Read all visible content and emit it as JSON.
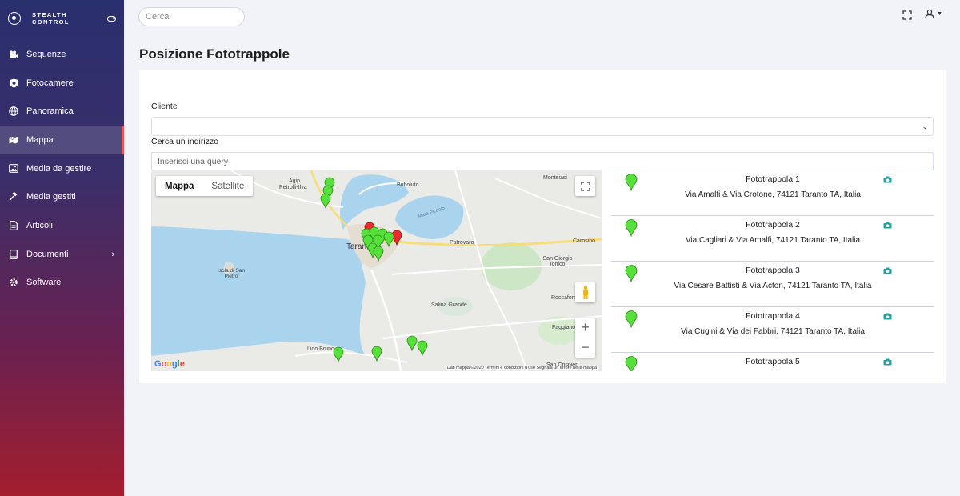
{
  "brand": {
    "name": "STEALTH CONTROL"
  },
  "sidebar": {
    "items": [
      {
        "label": "Sequenze",
        "icon": "video-camera-icon"
      },
      {
        "label": "Fotocamere",
        "icon": "camera-shield-icon"
      },
      {
        "label": "Panoramica",
        "icon": "globe-icon"
      },
      {
        "label": "Mappa",
        "icon": "map-icon",
        "active": true
      },
      {
        "label": "Media da gestire",
        "icon": "image-icon"
      },
      {
        "label": "Media gestiti",
        "icon": "gavel-icon"
      },
      {
        "label": "Articoli",
        "icon": "document-icon"
      },
      {
        "label": "Documenti",
        "icon": "book-icon",
        "has_submenu": true
      },
      {
        "label": "Software",
        "icon": "gear-icon"
      }
    ]
  },
  "topbar": {
    "search_placeholder": "Cerca"
  },
  "page": {
    "title": "Posizione Fototrappole"
  },
  "form": {
    "client_label": "Cliente",
    "client_value": "",
    "address_label": "Cerca un indirizzo",
    "address_placeholder": "Inserisci una query"
  },
  "map": {
    "type_map": "Mappa",
    "type_satellite": "Satellite",
    "google_logo": "Google",
    "attribution": "Dati mappa ©2020    Termini e condizioni d'uso    Segnala un errore nella mappa",
    "labels": {
      "agip": "Agip",
      "petroli": "Petrolli-Ilva",
      "buffoluto": "Buffoluto",
      "mare_piccolo": "Mare Piccolo",
      "montelasi": "Monteiasi",
      "taranto": "Taranto",
      "patrovaro": "Patrovaro",
      "carosino": "Carosino",
      "san_giorgio": "San Giorgio Ionico",
      "isola": "Isola di San Pietro",
      "salina": "Salina Grande",
      "roccaforzata": "Roccaforzata",
      "faggiano": "Faggiano",
      "lido_bruno": "Lido Bruno",
      "san_crispieri": "San Crispieri"
    },
    "marker_colors": {
      "active": "#55e03a",
      "alert": "#ea2b2b"
    }
  },
  "traps": [
    {
      "name": "Fototrappola 1",
      "address": "Via Amalfi & Via Crotone, 74121 Taranto TA, Italia"
    },
    {
      "name": "Fototrappola 2",
      "address": "Via Cagliari & Via Amalfi, 74121 Taranto TA, Italia"
    },
    {
      "name": "Fototrappola 3",
      "address": "Via Cesare Battisti & Via Acton, 74121 Taranto TA, Italia"
    },
    {
      "name": "Fototrappola 4",
      "address": "Via Cugini & Via dei Fabbri, 74121 Taranto TA, Italia"
    },
    {
      "name": "Fototrappola 5",
      "address": ""
    }
  ]
}
